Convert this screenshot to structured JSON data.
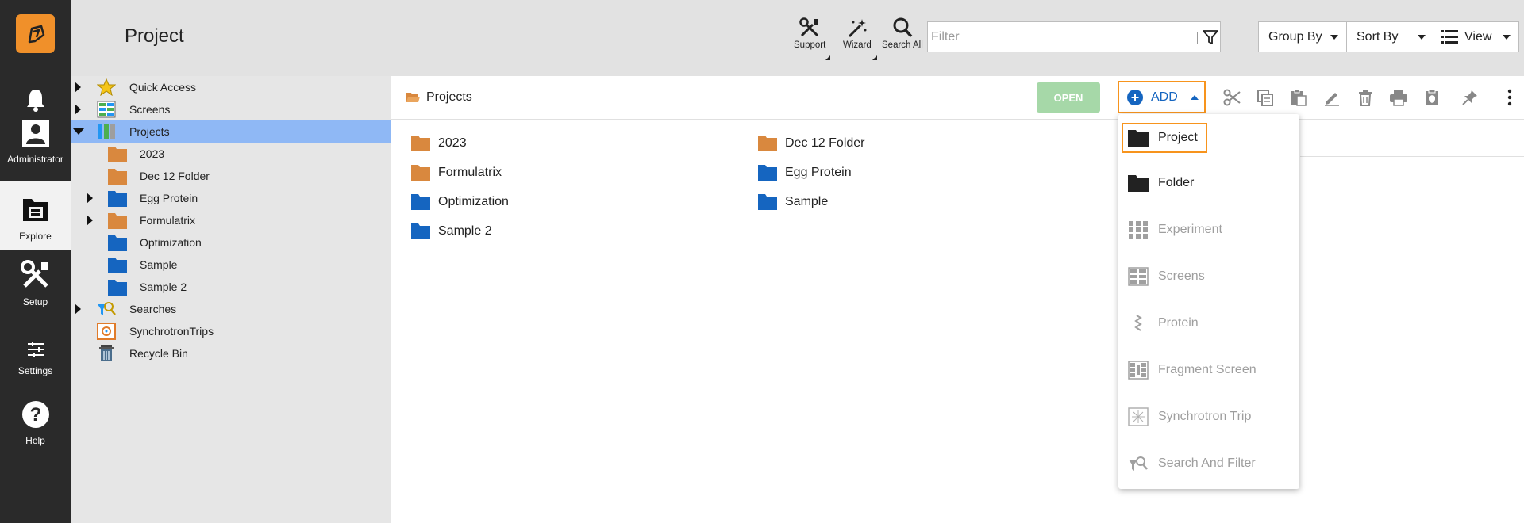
{
  "app": {
    "page_title": "Project"
  },
  "rail": {
    "items": [
      {
        "label": "",
        "icon": "bell-icon"
      },
      {
        "label": "Administrator",
        "icon": "user-icon"
      },
      {
        "label": "Explore",
        "icon": "explore-icon"
      },
      {
        "label": "Setup",
        "icon": "tools-icon"
      },
      {
        "label": "Settings",
        "icon": "sliders-icon"
      },
      {
        "label": "Help",
        "icon": "help-icon"
      }
    ]
  },
  "header": {
    "support_label": "Support",
    "wizard_label": "Wizard",
    "search_all_label": "Search All",
    "filter_placeholder": "Filter",
    "group_by_label": "Group By",
    "sort_by_label": "Sort By",
    "view_label": "View"
  },
  "tree": {
    "nodes": [
      {
        "label": "Quick Access",
        "icon": "star-icon",
        "expandable": true
      },
      {
        "label": "Screens",
        "icon": "screens-icon",
        "expandable": true
      },
      {
        "label": "Projects",
        "icon": "projects-icon",
        "expandable": true,
        "expanded": true,
        "selected": true
      },
      {
        "label": "2023",
        "icon": "folder-orange-icon"
      },
      {
        "label": "Dec 12 Folder",
        "icon": "folder-orange-icon"
      },
      {
        "label": "Egg Protein",
        "icon": "folder-blue-icon",
        "expandable": true
      },
      {
        "label": "Formulatrix",
        "icon": "folder-orange-icon",
        "expandable": true
      },
      {
        "label": "Optimization",
        "icon": "folder-blue-icon"
      },
      {
        "label": "Sample",
        "icon": "folder-blue-icon"
      },
      {
        "label": "Sample 2",
        "icon": "folder-blue-icon"
      },
      {
        "label": "Searches",
        "icon": "searches-icon",
        "expandable": true
      },
      {
        "label": "SynchrotronTrips",
        "icon": "synchrotron-icon"
      },
      {
        "label": "Recycle Bin",
        "icon": "recycle-bin-icon"
      }
    ]
  },
  "content": {
    "breadcrumb": "Projects",
    "open_label": "OPEN",
    "add_label": "ADD",
    "items_col1": [
      "2023",
      "Formulatrix",
      "Optimization",
      "Sample 2"
    ],
    "items_col2": [
      "Dec 12 Folder",
      "Egg Protein",
      "Sample"
    ]
  },
  "add_menu": {
    "items": [
      {
        "label": "Project",
        "enabled": true,
        "highlighted": true
      },
      {
        "label": "Folder",
        "enabled": true
      },
      {
        "label": "Experiment",
        "enabled": false
      },
      {
        "label": "Screens",
        "enabled": false
      },
      {
        "label": "Protein",
        "enabled": false
      },
      {
        "label": "Fragment Screen",
        "enabled": false
      },
      {
        "label": "Synchrotron Trip",
        "enabled": false
      },
      {
        "label": "Search And Filter",
        "enabled": false
      }
    ]
  },
  "colors": {
    "accent_orange": "#f7941d",
    "folder_orange": "#d9883e",
    "folder_blue": "#1565c0",
    "selected_row": "#8fb8f5",
    "open_button": "#a6d8a8"
  }
}
